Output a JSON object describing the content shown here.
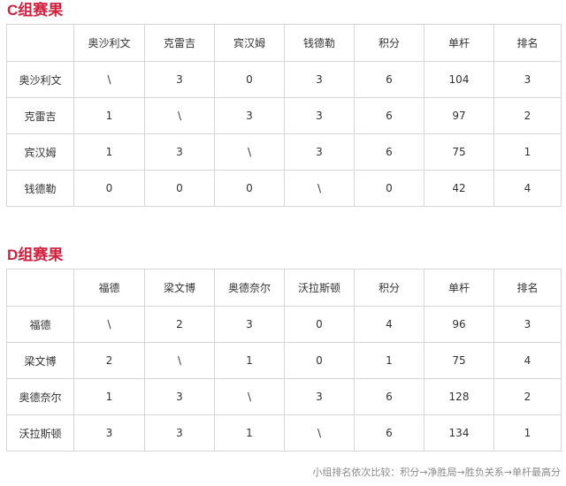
{
  "groups": [
    {
      "title": "C组赛果",
      "headers": [
        "",
        "奥沙利文",
        "克雷吉",
        "宾汉姆",
        "钱德勒",
        "积分",
        "单杆",
        "排名"
      ],
      "rows": [
        [
          "奥沙利文",
          "\\",
          "3",
          "0",
          "3",
          "6",
          "104",
          "3"
        ],
        [
          "克雷吉",
          "1",
          "\\",
          "3",
          "3",
          "6",
          "97",
          "2"
        ],
        [
          "宾汉姆",
          "1",
          "3",
          "\\",
          "3",
          "6",
          "75",
          "1"
        ],
        [
          "钱德勒",
          "0",
          "0",
          "0",
          "\\",
          "0",
          "42",
          "4"
        ]
      ]
    },
    {
      "title": "D组赛果",
      "headers": [
        "",
        "福德",
        "梁文博",
        "奥德奈尔",
        "沃拉斯顿",
        "积分",
        "单杆",
        "排名"
      ],
      "rows": [
        [
          "福德",
          "\\",
          "2",
          "3",
          "0",
          "4",
          "96",
          "3"
        ],
        [
          "梁文博",
          "2",
          "\\",
          "1",
          "0",
          "1",
          "75",
          "4"
        ],
        [
          "奥德奈尔",
          "1",
          "3",
          "\\",
          "3",
          "6",
          "128",
          "2"
        ],
        [
          "沃拉斯顿",
          "3",
          "3",
          "1",
          "\\",
          "6",
          "134",
          "1"
        ]
      ]
    }
  ],
  "footnote": "小组排名依次比较：积分→净胜局→胜负关系→单杆最高分",
  "colors": {
    "title": "#d0213f",
    "border": "#d6d6d6",
    "text": "#333333",
    "note": "#8a8a8a"
  }
}
